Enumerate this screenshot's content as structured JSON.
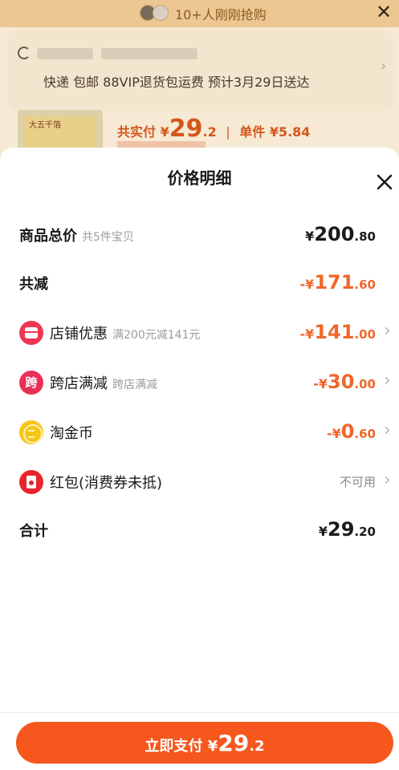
{
  "background": {
    "buyers_banner": "10+人刚刚抢购",
    "shipping_line": "快递 包邮 88VIP退货包运费 预计3月29日送达",
    "thumb_title": "大五千箔",
    "paid_label": "共实付",
    "paid_currency": "¥",
    "paid_int": "29",
    "paid_dec": ".2",
    "paid_sep": "|",
    "unit_price": "单件 ¥5.84"
  },
  "sheet": {
    "title": "价格明细",
    "rows": [
      {
        "label": "商品总价",
        "sub": "共5件宝贝",
        "currency": "¥",
        "int": "200",
        "dec": ".80"
      },
      {
        "label": "共减",
        "sub": "",
        "currency": "-¥",
        "int": "171",
        "dec": ".60"
      },
      {
        "label": "店铺优惠",
        "sub": "满200元减141元",
        "icon": "shop-icon",
        "currency": "-¥",
        "int": "141",
        "dec": ".00"
      },
      {
        "label": "跨店满减",
        "sub": "跨店满减",
        "icon": "cross-store-icon",
        "icon_glyph": "跨",
        "currency": "-¥",
        "int": "30",
        "dec": ".00"
      },
      {
        "label": "淘金币",
        "sub": "",
        "icon": "gold-coin-icon",
        "currency": "-¥",
        "int": "0",
        "dec": ".60"
      },
      {
        "label": "红包(消费券未抵)",
        "sub": "",
        "icon": "red-packet-icon",
        "status": "不可用"
      },
      {
        "label": "合计",
        "sub": "",
        "currency": "¥",
        "int": "29",
        "dec": ".20"
      }
    ],
    "pay_button": {
      "label": "立即支付",
      "currency": "¥",
      "int": "29",
      "dec": ".2"
    }
  },
  "colors": {
    "accent": "#f6571d",
    "discount": "#f1662a",
    "shop_icon": "#ef3654",
    "coin_icon": "#f6c518"
  }
}
